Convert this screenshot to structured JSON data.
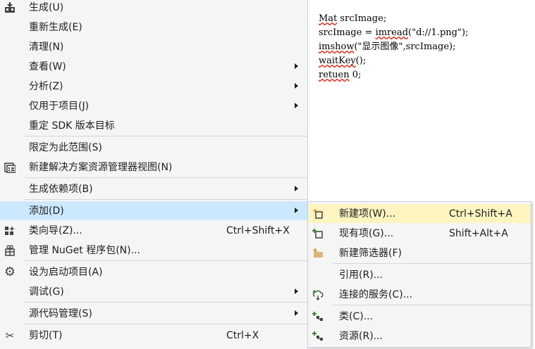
{
  "editor": {
    "lines": [
      "Mat srcImage;",
      "srcImage = imread(\"d://1.png\");",
      "imshow(\"显示图像\",srcImage);",
      "waitKey();",
      "retuen 0;"
    ]
  },
  "menu": {
    "build": "生成(U)",
    "rebuild": "重新生成(E)",
    "clean": "清理(N)",
    "view": "查看(W)",
    "analyze": "分析(Z)",
    "project_only": "仅用于项目(J)",
    "retarget_sdk": "重定 SDK 版本目标",
    "scope_to_this": "限定为此范围(S)",
    "new_solution_explorer_view": "新建解决方案资源管理器视图(N)",
    "build_dependencies": "生成依赖项(B)",
    "add": "添加(D)",
    "class_wizard": "类向导(Z)...",
    "class_wizard_shortcut": "Ctrl+Shift+X",
    "manage_nuget": "管理 NuGet 程序包(N)...",
    "set_startup": "设为启动项目(A)",
    "debug": "调试(G)",
    "source_control": "源代码管理(S)",
    "cut": "剪切(T)",
    "cut_shortcut": "Ctrl+X"
  },
  "submenu": {
    "new_item": "新建项(W)...",
    "new_item_shortcut": "Ctrl+Shift+A",
    "existing_item": "现有项(G)...",
    "existing_item_shortcut": "Shift+Alt+A",
    "new_filter": "新建筛选器(F)",
    "reference": "引用(R)...",
    "connected_services": "连接的服务(C)...",
    "class": "类(C)...",
    "resource": "资源(R)..."
  },
  "colors": {
    "menu_bg": "#f5f5f5",
    "hover_main": "#cce8ff",
    "hover_sub": "#fdf4bf",
    "squiggle": "#e51400"
  }
}
